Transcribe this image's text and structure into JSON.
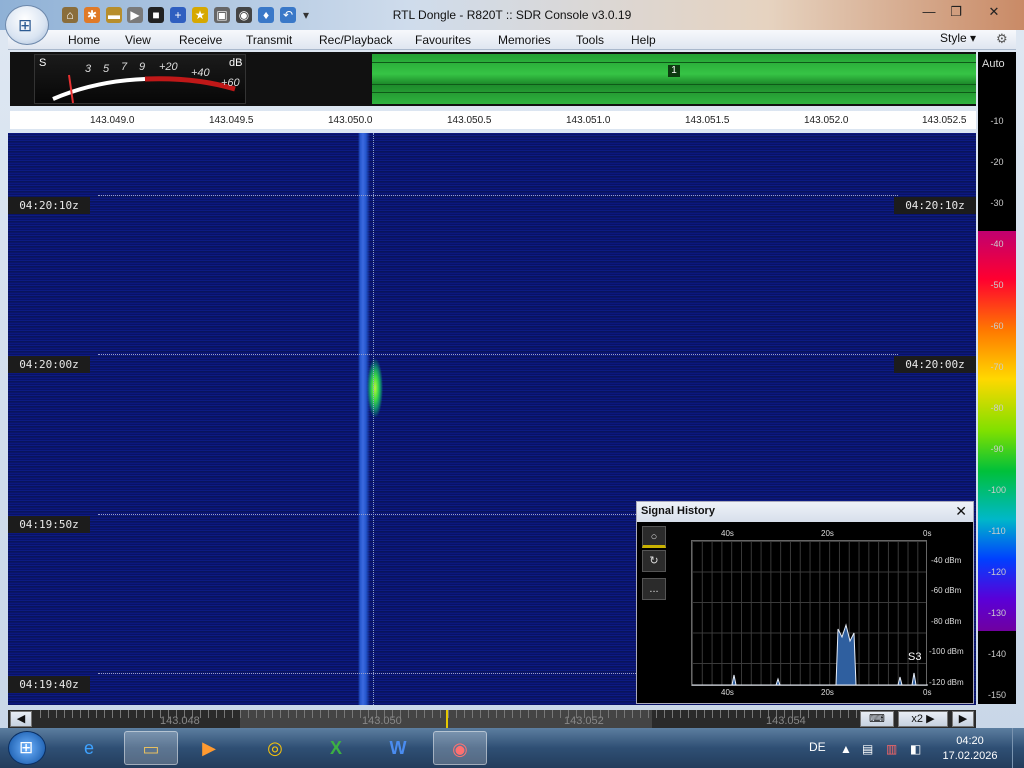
{
  "window": {
    "title": "RTL Dongle - R820T :: SDR Console v3.0.19",
    "minimize_label": "—",
    "maximize_label": "❐",
    "close_label": "✕"
  },
  "menu": {
    "items": [
      "Home",
      "View",
      "Receive",
      "Transmit",
      "Rec/Playback",
      "Favourites",
      "Memories",
      "Tools",
      "Help"
    ],
    "style_label": "Style"
  },
  "smeter": {
    "s_label": "S",
    "db_label": "dB",
    "ticks": [
      "3",
      "5",
      "7",
      "9",
      "+20",
      "+40",
      "+60"
    ]
  },
  "band": {
    "marker": "1"
  },
  "freq_scale": [
    "143.049.0",
    "143.049.5",
    "143.050.0",
    "143.050.5",
    "143.051.0",
    "143.051.5",
    "143.052.0",
    "143.052.5"
  ],
  "colorbar": {
    "auto_label": "Auto",
    "levels": [
      "-10",
      "-20",
      "-30",
      "-40",
      "-50",
      "-60",
      "-70",
      "-80",
      "-90",
      "-100",
      "-110",
      "-120",
      "-130",
      "-140",
      "-150"
    ]
  },
  "waterfall": {
    "time_labels": [
      "04:20:10z",
      "04:20:00z",
      "04:19:50z",
      "04:19:40z"
    ]
  },
  "signal_history": {
    "title": "Signal History",
    "top_axis": [
      "40s",
      "20s",
      "0s"
    ],
    "bottom_axis": [
      "40s",
      "20s",
      "0s"
    ],
    "dbm_labels": [
      "-40 dBm",
      "-60 dBm",
      "-80 dBm",
      "-100 dBm",
      "-120 dBm"
    ],
    "s_reading": "S3",
    "tools": [
      "○",
      "↻",
      "..."
    ]
  },
  "scrollbar": {
    "freqs": [
      "143.048",
      "143.050",
      "143.052",
      "143.054"
    ],
    "zoom_label": "x2",
    "position_fraction": 0.45
  },
  "taskbar": {
    "lang": "DE",
    "time": "04:20",
    "date": "17.02.2026"
  },
  "colors": {
    "accent": "#2fb33e",
    "waterfall_bg": "#0b1670"
  },
  "icons": [
    "start-orb-icon",
    "ie-icon",
    "explorer-icon",
    "media-player-icon",
    "chrome-icon",
    "excel-icon",
    "word-icon",
    "sdr-console-icon"
  ]
}
